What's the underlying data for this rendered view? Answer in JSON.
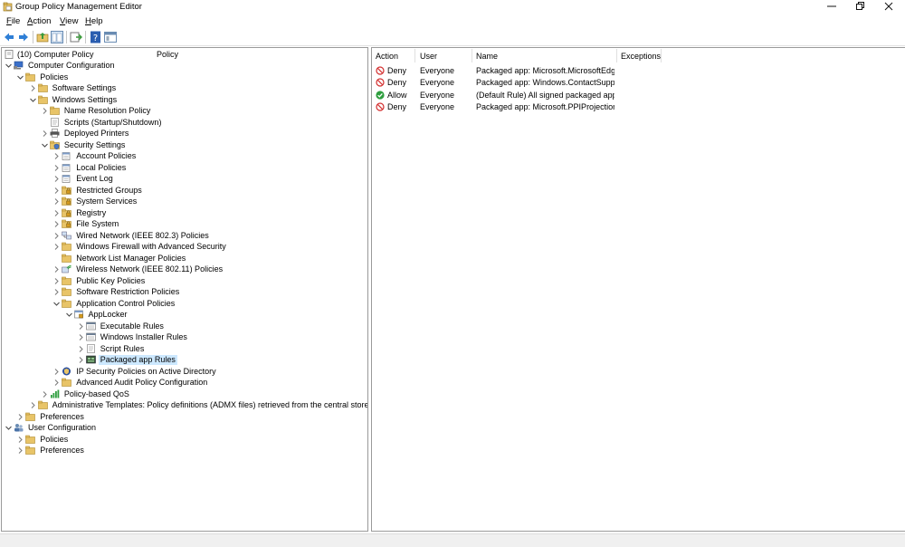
{
  "window": {
    "title": "Group Policy Management Editor"
  },
  "menu": {
    "items": [
      {
        "label": "File",
        "key": "F",
        "rest": "ile"
      },
      {
        "label": "Action",
        "key": "A",
        "rest": "ction"
      },
      {
        "label": "View",
        "key": "V",
        "rest": "iew"
      },
      {
        "label": "Help",
        "key": "H",
        "rest": "elp"
      }
    ]
  },
  "toolbar": {
    "icons": [
      "back-icon",
      "forward-icon",
      "up-folder-icon",
      "show-hide-tree-icon",
      "export-list-icon",
      "help-icon",
      "properties-icon"
    ]
  },
  "tree": {
    "root_label": "(10) Computer Policy",
    "column_label": "Policy",
    "nodes": [
      {
        "label": "Computer Configuration",
        "depth": 0,
        "expander": "open",
        "icon": "computer-icon"
      },
      {
        "label": "Policies",
        "depth": 1,
        "expander": "open",
        "icon": "folder-icon"
      },
      {
        "label": "Software Settings",
        "depth": 2,
        "expander": "closed",
        "icon": "folder-icon"
      },
      {
        "label": "Windows Settings",
        "depth": 2,
        "expander": "open",
        "icon": "folder-icon"
      },
      {
        "label": "Name Resolution Policy",
        "depth": 3,
        "expander": "closed",
        "icon": "folder-icon"
      },
      {
        "label": "Scripts (Startup/Shutdown)",
        "depth": 3,
        "expander": "none",
        "icon": "script-icon"
      },
      {
        "label": "Deployed Printers",
        "depth": 3,
        "expander": "closed",
        "icon": "printer-icon"
      },
      {
        "label": "Security Settings",
        "depth": 3,
        "expander": "open",
        "icon": "security-icon"
      },
      {
        "label": "Account Policies",
        "depth": 4,
        "expander": "closed",
        "icon": "policy-icon"
      },
      {
        "label": "Local Policies",
        "depth": 4,
        "expander": "closed",
        "icon": "policy-icon"
      },
      {
        "label": "Event Log",
        "depth": 4,
        "expander": "closed",
        "icon": "policy-icon"
      },
      {
        "label": "Restricted Groups",
        "depth": 4,
        "expander": "closed",
        "icon": "lock-folder-icon"
      },
      {
        "label": "System Services",
        "depth": 4,
        "expander": "closed",
        "icon": "lock-folder-icon"
      },
      {
        "label": "Registry",
        "depth": 4,
        "expander": "closed",
        "icon": "lock-folder-icon"
      },
      {
        "label": "File System",
        "depth": 4,
        "expander": "closed",
        "icon": "lock-folder-icon"
      },
      {
        "label": "Wired Network (IEEE 802.3) Policies",
        "depth": 4,
        "expander": "closed",
        "icon": "network-icon"
      },
      {
        "label": "Windows Firewall with Advanced Security",
        "depth": 4,
        "expander": "closed",
        "icon": "folder-icon"
      },
      {
        "label": "Network List Manager Policies",
        "depth": 4,
        "expander": "none",
        "icon": "folder-icon"
      },
      {
        "label": "Wireless Network (IEEE 802.11) Policies",
        "depth": 4,
        "expander": "closed",
        "icon": "wireless-icon"
      },
      {
        "label": "Public Key Policies",
        "depth": 4,
        "expander": "closed",
        "icon": "folder-icon"
      },
      {
        "label": "Software Restriction Policies",
        "depth": 4,
        "expander": "closed",
        "icon": "folder-icon"
      },
      {
        "label": "Application Control Policies",
        "depth": 4,
        "expander": "open",
        "icon": "folder-icon"
      },
      {
        "label": "AppLocker",
        "depth": 5,
        "expander": "open",
        "icon": "applocker-icon"
      },
      {
        "label": "Executable Rules",
        "depth": 6,
        "expander": "closed",
        "icon": "rules-icon"
      },
      {
        "label": "Windows Installer Rules",
        "depth": 6,
        "expander": "closed",
        "icon": "rules-icon"
      },
      {
        "label": "Script Rules",
        "depth": 6,
        "expander": "closed",
        "icon": "script-icon"
      },
      {
        "label": "Packaged app Rules",
        "depth": 6,
        "expander": "closed",
        "icon": "packaged-app-icon",
        "selected": true
      },
      {
        "label": "IP Security Policies on Active Directory",
        "depth": 4,
        "expander": "closed",
        "icon": "ipsec-icon"
      },
      {
        "label": "Advanced Audit Policy Configuration",
        "depth": 4,
        "expander": "closed",
        "icon": "folder-icon"
      },
      {
        "label": "Policy-based QoS",
        "depth": 3,
        "expander": "closed",
        "icon": "qos-icon"
      },
      {
        "label": "Administrative Templates: Policy definitions (ADMX files) retrieved from the central store.",
        "depth": 2,
        "expander": "closed",
        "icon": "folder-icon"
      },
      {
        "label": "Preferences",
        "depth": 1,
        "expander": "closed",
        "icon": "folder-icon"
      },
      {
        "label": "User Configuration",
        "depth": 0,
        "expander": "open",
        "icon": "users-icon"
      },
      {
        "label": "Policies",
        "depth": 1,
        "expander": "closed",
        "icon": "folder-icon"
      },
      {
        "label": "Preferences",
        "depth": 1,
        "expander": "closed",
        "icon": "folder-icon"
      }
    ]
  },
  "list": {
    "columns": [
      "Action",
      "User",
      "Name",
      "Exceptions"
    ],
    "rows": [
      {
        "action": "Deny",
        "user": "Everyone",
        "name": "Packaged app: Microsoft.MicrosoftEdg...",
        "exceptions": ""
      },
      {
        "action": "Deny",
        "user": "Everyone",
        "name": "Packaged app: Windows.ContactSuppo...",
        "exceptions": ""
      },
      {
        "action": "Allow",
        "user": "Everyone",
        "name": "(Default Rule) All signed packaged apps",
        "exceptions": ""
      },
      {
        "action": "Deny",
        "user": "Everyone",
        "name": "Packaged app: Microsoft.PPIProjection ...",
        "exceptions": ""
      }
    ]
  },
  "colors": {
    "selection": "#cce8ff",
    "deny": "#d32f2f",
    "allow": "#2e9e3e",
    "folder": "#e8c468"
  }
}
